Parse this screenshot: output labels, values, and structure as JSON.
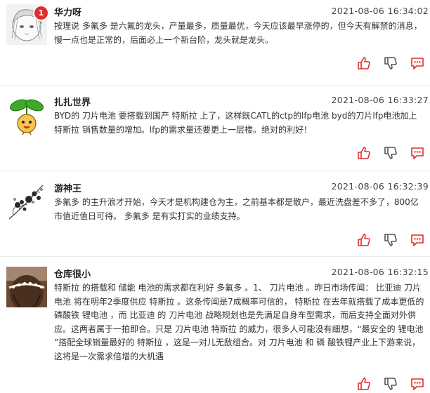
{
  "comments": [
    {
      "user": "华力呀",
      "time": "2021-08-06 16:34:02",
      "badge": "1",
      "avatar": "sketch-avatar",
      "text": "按理说 多氟多 是六氟的龙头，产量最多，质量最优，今天应该最早涨停的，但今天有解禁的消息，慢一点也是正常的，后面必上一个新台阶，龙头就是龙头。"
    },
    {
      "user": "扎扎世界",
      "time": "2021-08-06 16:33:27",
      "avatar": "sprout-avatar",
      "text": "BYD的 刀片电池 要搭载到国产 特斯拉 上了，这样既CATL的ctp的lfp电池 byd的刀片lfp电池加上 特斯拉 销售数量的增加。lfp的需求量还要更上一层楼。绝对的利好！"
    },
    {
      "user": "游神王",
      "time": "2021-08-06 16:32:39",
      "avatar": "flower-avatar",
      "text": "多氟多 的主升浪才开始，今天才是机构建仓为主，之前基本都是散户，最近洗盘差不多了，800亿市值近值日可待。 多氟多 是有实打实的业绩支持。"
    },
    {
      "user": "仓库很小",
      "time": "2021-08-06 16:32:15",
      "avatar": "portrait-avatar",
      "text": "特斯拉 的搭载和 储能 电池的需求都在利好 多氟多 。1、 刀片电池 。昨日市场传闻： 比亚迪 刀片电池 将在明年2季度供应 特斯拉 。这条传闻是7成概率可信的， 特斯拉 在去年就搭载了成本更低的 磷酸铁 锂电池 ，而 比亚迪 的 刀片电池 战略规划也是先满足自身车型需求，而后支持全面对外供应。这两者属于一拍即合。只是 刀片电池 特斯拉 的威力，很多人可能没有细想，“最安全的 锂电池 ”搭配全球销量最好的 特斯拉 ，这是一对儿无敌组合。对 刀片电池 和 磷 酸铁锂产业上下游来说，这将是一次需求倍增的大机遇"
    }
  ],
  "colors": {
    "accent": "#e12e2e",
    "text": "#333333",
    "divider": "#ececec"
  },
  "action_icons": [
    "thumbs-up-icon",
    "thumbs-down-icon",
    "comment-icon"
  ]
}
